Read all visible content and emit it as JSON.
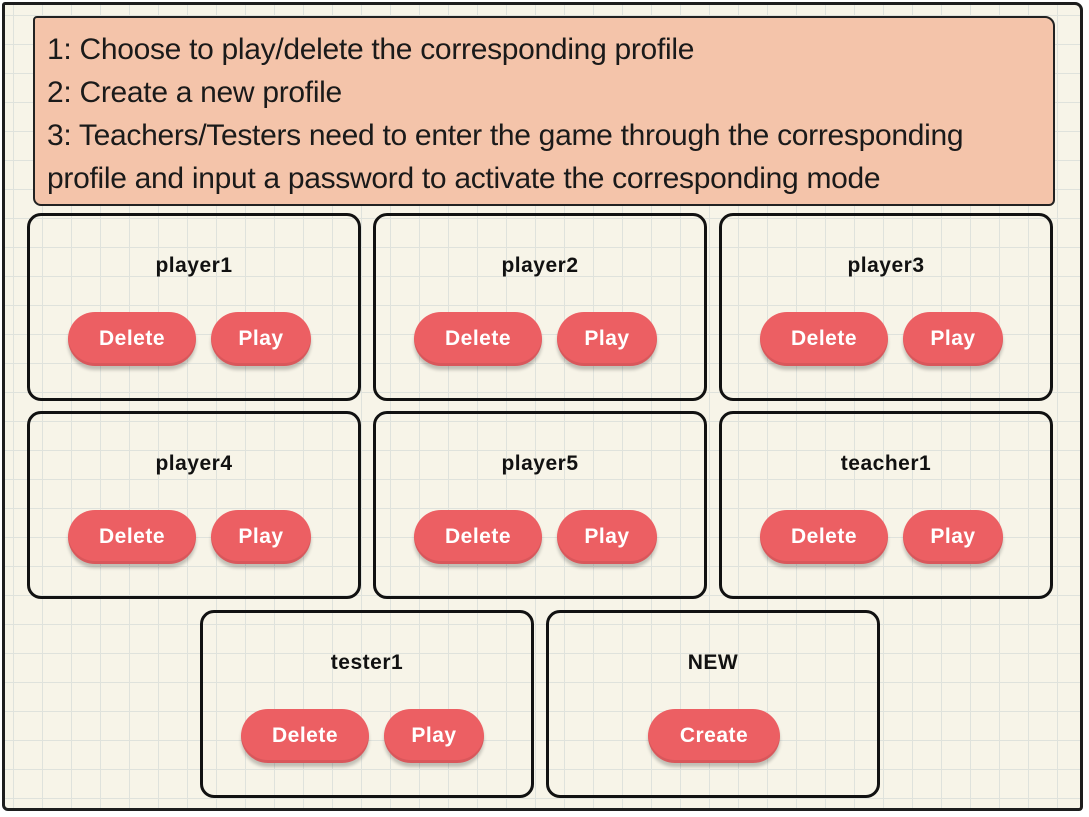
{
  "instructions": {
    "lines": [
      "1: Choose to play/delete the corresponding profile",
      "2: Create a new profile",
      "3: Teachers/Testers need to enter the game through the corresponding",
      "profile and input a password to activate the corresponding mode"
    ]
  },
  "profiles": [
    {
      "name": "player1",
      "delete_label": "Delete",
      "play_label": "Play"
    },
    {
      "name": "player2",
      "delete_label": "Delete",
      "play_label": "Play"
    },
    {
      "name": "player3",
      "delete_label": "Delete",
      "play_label": "Play"
    },
    {
      "name": "player4",
      "delete_label": "Delete",
      "play_label": "Play"
    },
    {
      "name": "player5",
      "delete_label": "Delete",
      "play_label": "Play"
    },
    {
      "name": "teacher1",
      "delete_label": "Delete",
      "play_label": "Play"
    },
    {
      "name": "tester1",
      "delete_label": "Delete",
      "play_label": "Play"
    }
  ],
  "new_profile": {
    "title": "NEW",
    "create_label": "Create"
  },
  "colors": {
    "button": "#ec5f63",
    "instructions_bg": "#f4c4aa",
    "page_bg": "#f7f4e8"
  }
}
